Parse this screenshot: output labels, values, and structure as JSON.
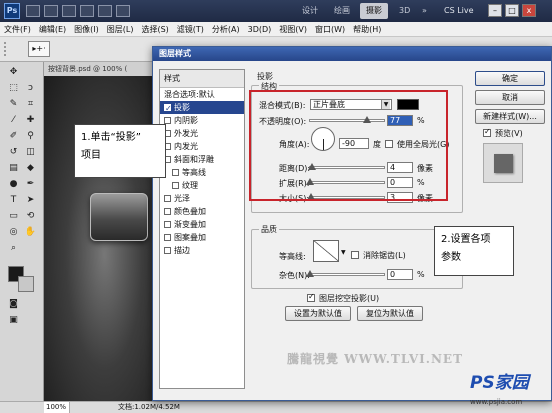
{
  "app": {
    "logo": "Ps",
    "workspaces": [
      "设计",
      "绘画",
      "摄影",
      "3D"
    ],
    "active_workspace": "摄影",
    "more_button": "»",
    "cs_live": "CS Live",
    "window_buttons": [
      "–",
      "□",
      "x"
    ]
  },
  "menubar": {
    "items": [
      "文件(F)",
      "编辑(E)",
      "图像(I)",
      "图层(L)",
      "选择(S)",
      "滤镜(T)",
      "分析(A)",
      "3D(D)",
      "视图(V)",
      "窗口(W)",
      "帮助(H)"
    ]
  },
  "options_bar": {
    "tool_preset": "▸+·"
  },
  "document": {
    "tab_title": "按钮背景.psd @ 100% (",
    "zoom": "100%",
    "info": "文档:1.02M/4.52M"
  },
  "dialog": {
    "title": "图层样式",
    "styles_header": "样式",
    "styles": [
      {
        "label": "混合选项:默认",
        "sub": false,
        "checkbox": false
      },
      {
        "label": "投影",
        "sub": false,
        "checkbox": true,
        "checked": true,
        "selected": true
      },
      {
        "label": "内阴影",
        "sub": false,
        "checkbox": true
      },
      {
        "label": "外发光",
        "sub": false,
        "checkbox": true
      },
      {
        "label": "内发光",
        "sub": false,
        "checkbox": true
      },
      {
        "label": "斜面和浮雕",
        "sub": false,
        "checkbox": true
      },
      {
        "label": "等高线",
        "sub": true,
        "checkbox": true
      },
      {
        "label": "纹理",
        "sub": true,
        "checkbox": true
      },
      {
        "label": "光泽",
        "sub": false,
        "checkbox": true
      },
      {
        "label": "颜色叠加",
        "sub": false,
        "checkbox": true
      },
      {
        "label": "渐变叠加",
        "sub": false,
        "checkbox": true
      },
      {
        "label": "图案叠加",
        "sub": false,
        "checkbox": true
      },
      {
        "label": "描边",
        "sub": false,
        "checkbox": true
      }
    ],
    "shadow": {
      "section_title": "投影",
      "structure_title": "结构",
      "blend_mode_label": "混合模式(B):",
      "blend_mode_value": "正片叠底",
      "shadow_color": "#000000",
      "opacity_label": "不透明度(O):",
      "opacity_value": "77",
      "opacity_unit": "%",
      "opacity_slider": 0.77,
      "angle_label": "角度(A):",
      "angle_value": "-90",
      "angle_unit": "度",
      "global_light_label": "使用全局光(G)",
      "distance_label": "距离(D):",
      "distance_value": "4",
      "distance_unit": "像素",
      "distance_slider": 0.03,
      "spread_label": "扩展(R):",
      "spread_value": "0",
      "spread_unit": "%",
      "spread_slider": 0.0,
      "size_label": "大小(S):",
      "size_value": "3",
      "size_unit": "像素",
      "size_slider": 0.02
    },
    "quality": {
      "title": "品质",
      "contour_label": "等高线:",
      "antialias_label": "消除锯齿(L)",
      "noise_label": "杂色(N):",
      "noise_value": "0",
      "noise_unit": "%",
      "noise_slider": 0.0
    },
    "knockout_label": "图层挖空投影(U)",
    "knockout_checked": true,
    "set_default_label": "设置为默认值",
    "reset_default_label": "复位为默认值",
    "buttons": {
      "ok": "确定",
      "cancel": "取消",
      "new_style": "新建样式(W)...",
      "preview_label": "预览(V)",
      "preview_checked": true
    }
  },
  "annotations": {
    "step1": [
      "1.单击“投影”",
      "项目"
    ],
    "step2": [
      "2.设置各项",
      "参数"
    ]
  },
  "watermark": {
    "text": "騰龍視覺 WWW.TLVI.NET",
    "logo": "PS家园",
    "url": "www.psjia.com"
  },
  "colors": {
    "selection_blue": "#26468f",
    "highlight_red": "#c8242b"
  }
}
